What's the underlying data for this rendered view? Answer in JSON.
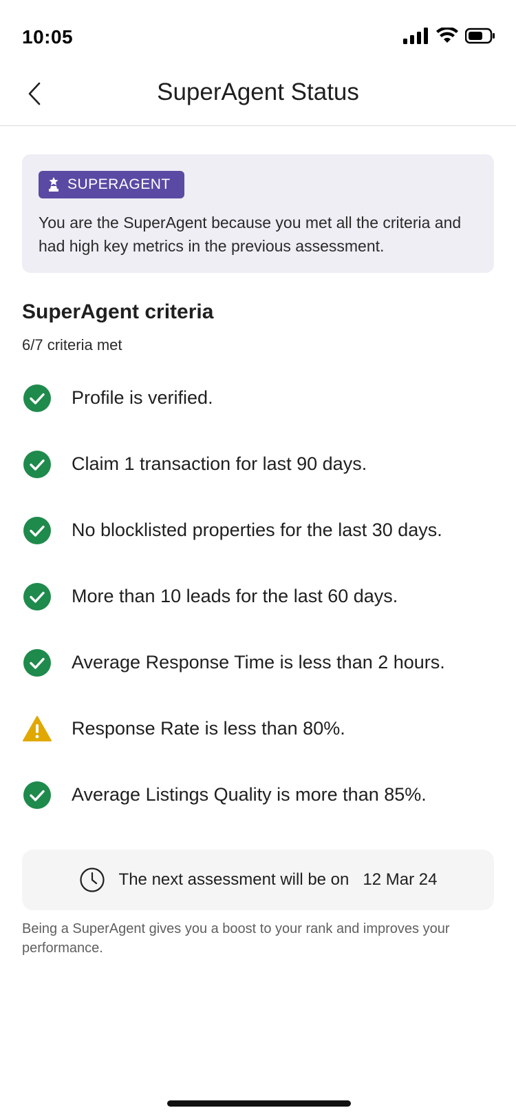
{
  "status_bar": {
    "time": "10:05"
  },
  "nav": {
    "title": "SuperAgent Status"
  },
  "banner": {
    "badge_label": "SUPERAGENT",
    "text": "You are the SuperAgent because you met all the criteria and had high key metrics in the previous assessment."
  },
  "criteria": {
    "title": "SuperAgent criteria",
    "summary": "6/7 criteria met",
    "items": [
      {
        "label": "Profile is verified.",
        "status": "met",
        "icon": "check-circle-icon"
      },
      {
        "label": "Claim 1 transaction for last 90 days.",
        "status": "met",
        "icon": "check-circle-icon"
      },
      {
        "label": "No blocklisted properties for the last 30 days.",
        "status": "met",
        "icon": "check-circle-icon"
      },
      {
        "label": "More than 10 leads for the last 60 days.",
        "status": "met",
        "icon": "check-circle-icon"
      },
      {
        "label": "Average Response Time is less than 2 hours.",
        "status": "met",
        "icon": "check-circle-icon"
      },
      {
        "label": "Response Rate is less than 80%.",
        "status": "warning",
        "icon": "warning-triangle-icon"
      },
      {
        "label": "Average Listings Quality is more than 85%.",
        "status": "met",
        "icon": "check-circle-icon"
      }
    ]
  },
  "assessment": {
    "text": "The next assessment will be on",
    "date": "12 Mar 24"
  },
  "footer": {
    "note": "Being a SuperAgent gives you a boost to your rank and improves your performance."
  },
  "colors": {
    "accent": "#5a4aa4",
    "success": "#1e8a4c",
    "warning": "#e0a800",
    "banner_bg": "#efeef5"
  }
}
